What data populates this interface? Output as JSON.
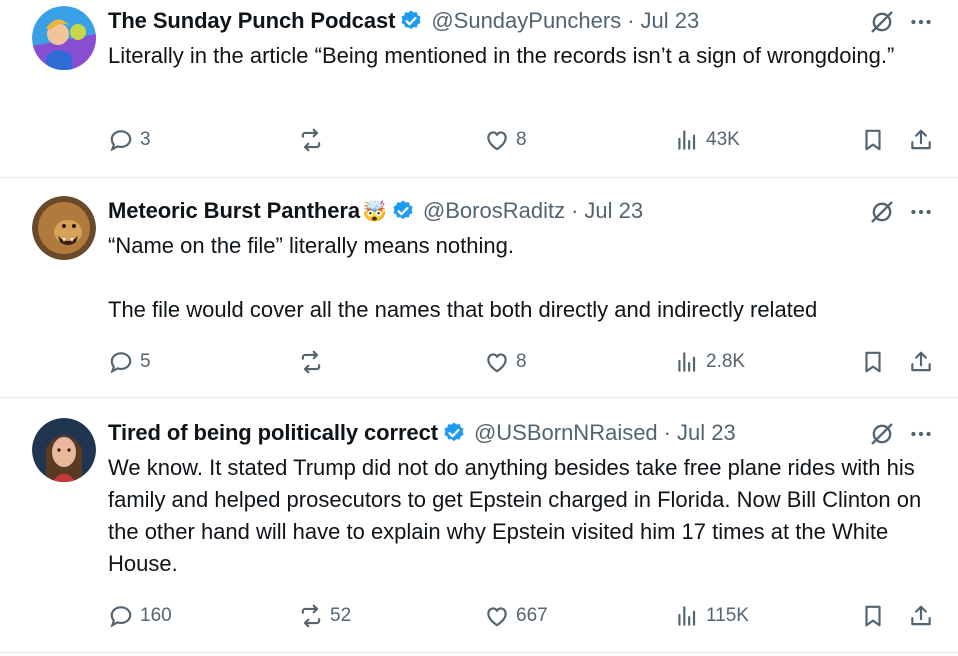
{
  "tweets": [
    {
      "name": "The Sunday Punch Podcast",
      "emoji": "",
      "handle": "@SundayPunchers",
      "separator": "·",
      "date": "Jul 23",
      "text": "Literally in the article “Being mentioned in the records isn’t a sign of wrongdoing.”",
      "replies": "3",
      "reposts": "",
      "likes": "8",
      "views": "43K"
    },
    {
      "name": "Meteoric Burst Panthera",
      "emoji": "🤯",
      "handle": "@BorosRaditz",
      "separator": "·",
      "date": "Jul 23",
      "text": "“Name on the file” literally means nothing.\n\nThe file would cover all the names that both directly and indirectly related",
      "replies": "5",
      "reposts": "",
      "likes": "8",
      "views": "2.8K"
    },
    {
      "name": "Tired of being politically correct",
      "emoji": "",
      "handle": "@USBornNRaised",
      "separator": "·",
      "date": "Jul 23",
      "text": "We know. It stated Trump did not do anything besides take free plane rides with his family and helped prosecutors to get Epstein charged in Florida. Now Bill Clinton on the other hand will have to explain why Epstein visited him 17 times at the White House.",
      "replies": "160",
      "reposts": "52",
      "likes": "667",
      "views": "115K"
    }
  ],
  "colors": {
    "verified": "#1d9bf0",
    "muted": "#536471",
    "text": "#0f1419",
    "divider": "#e7e9ea"
  },
  "icons": [
    "verified-badge-icon",
    "grok-icon",
    "more-icon",
    "reply-icon",
    "repost-icon",
    "like-icon",
    "views-icon",
    "bookmark-icon",
    "share-icon"
  ]
}
